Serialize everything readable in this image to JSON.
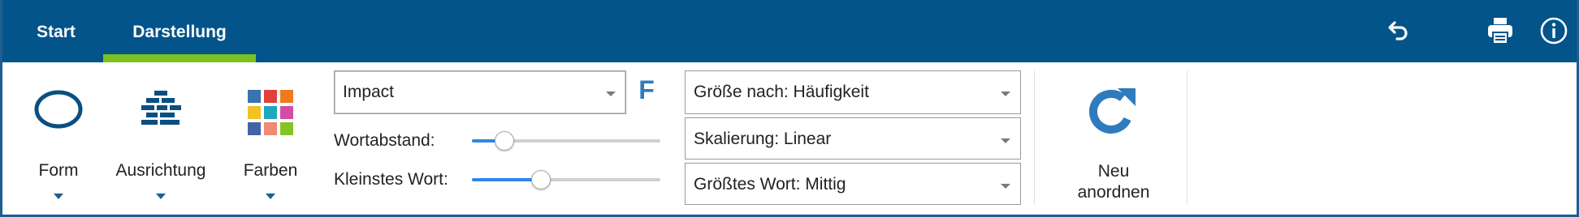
{
  "tabs": [
    {
      "label": "Start",
      "active": false
    },
    {
      "label": "Darstellung",
      "active": true
    }
  ],
  "toolbar_icons": [
    "undo-icon",
    "print-icon",
    "info-icon"
  ],
  "ribbon": {
    "form": {
      "label": "Form",
      "icon": "ellipse-icon"
    },
    "ausrichtung": {
      "label": "Ausrichtung",
      "icon": "align-icon"
    },
    "farben": {
      "label": "Farben",
      "icon": "palette-grid-icon"
    },
    "font": {
      "value": "Impact",
      "bold_label": "F"
    },
    "sliders": [
      {
        "label": "Wortabstand:",
        "value": 0.17
      },
      {
        "label": "Kleinstes Wort:",
        "value": 0.36
      }
    ],
    "selects": [
      {
        "value": "Größe nach: Häufigkeit"
      },
      {
        "value": "Skalierung: Linear"
      },
      {
        "value": "Größtes Wort: Mittig"
      }
    ],
    "neu_anordnen": {
      "line1": "Neu",
      "line2": "anordnen",
      "icon": "refresh-icon"
    }
  },
  "colors": {
    "header": "#03548a",
    "tab_indicator": "#7cc11f",
    "accent_blue": "#2f7bbd",
    "slider_fill": "#2f86e8"
  }
}
